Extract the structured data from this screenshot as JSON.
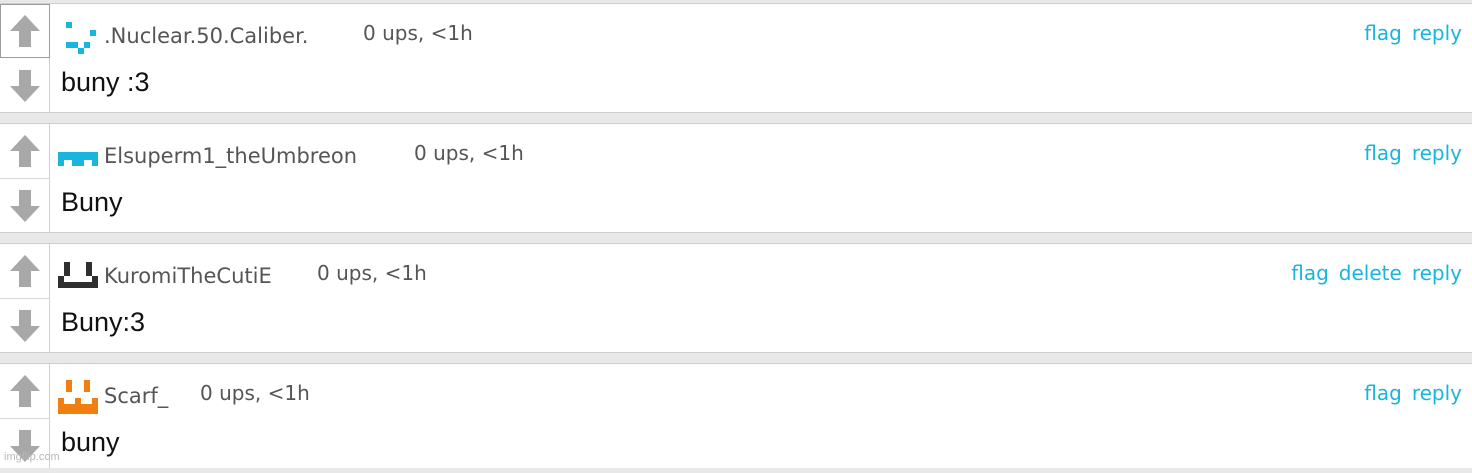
{
  "comments": [
    {
      "username": ".Nuclear.50.Caliber.",
      "meta": "0 ups, <1h",
      "text": "buny :3",
      "actions": [
        "flag",
        "reply"
      ],
      "avatar_color": "#1ab5dc"
    },
    {
      "username": "Elsuperm1_theUmbreon",
      "meta": "0 ups, <1h",
      "text": "Buny",
      "actions": [
        "flag",
        "reply"
      ],
      "avatar_color": "#1ab5dc"
    },
    {
      "username": "KuromiTheCutiE",
      "meta": "0 ups, <1h",
      "text": "Buny:3",
      "actions": [
        "flag",
        "delete",
        "reply"
      ],
      "avatar_color": "#2f2f2f"
    },
    {
      "username": "Scarf_",
      "meta": "0 ups, <1h",
      "text": "buny",
      "actions": [
        "flag",
        "reply"
      ],
      "avatar_color": "#f07f0f"
    }
  ],
  "icons": {
    "upvote": "arrow-up-icon",
    "downvote": "arrow-down-icon"
  },
  "colors": {
    "link": "#1ab5dc",
    "arrow": "#a8a8a8"
  },
  "watermark": "imgflip.com"
}
